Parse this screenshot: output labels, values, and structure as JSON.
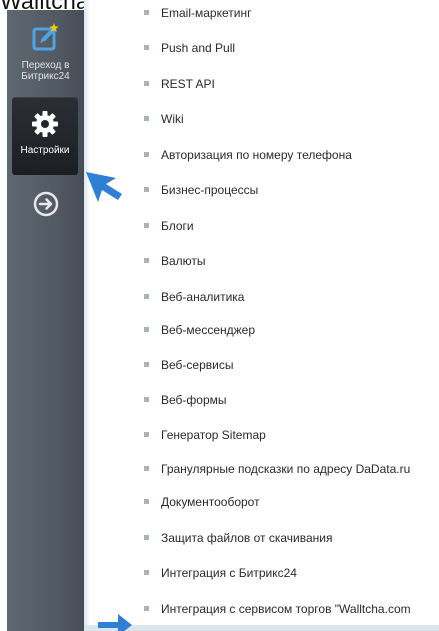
{
  "top_cropped_text": "Walltcha.com",
  "sidebar": {
    "items": [
      {
        "label": "Переход в Битрикс24",
        "icon": "bitrix24-edit-icon"
      },
      {
        "label": "Настройки",
        "icon": "gear-icon",
        "active": true
      },
      {
        "label": "",
        "icon": "circle-arrow-right-icon"
      }
    ]
  },
  "menu": {
    "items": [
      {
        "label": "Email-маркетинг"
      },
      {
        "label": "Push and Pull"
      },
      {
        "label": "REST API"
      },
      {
        "label": "Wiki"
      },
      {
        "label": "Авторизация по номеру телефона"
      },
      {
        "label": "Бизнес-процессы"
      },
      {
        "label": "Блоги"
      },
      {
        "label": "Валюты"
      },
      {
        "label": "Веб-аналитика"
      },
      {
        "label": "Веб-мессенджер"
      },
      {
        "label": "Веб-сервисы"
      },
      {
        "label": "Веб-формы"
      },
      {
        "label": "Генератор Sitemap"
      },
      {
        "label": "Гранулярные подсказки по адресу DaData.ru"
      },
      {
        "label": "Документооборот"
      },
      {
        "label": "Защита файлов от скачивания"
      },
      {
        "label": "Интеграция с Битрикс24"
      },
      {
        "label": "Интеграция с сервисом торгов \"Walltcha.com"
      }
    ]
  },
  "colors": {
    "sidebar": "#555d66",
    "active_item": "#22262b",
    "accent_arrow": "#2f7fd4",
    "bullet": "#a9b3bb"
  }
}
